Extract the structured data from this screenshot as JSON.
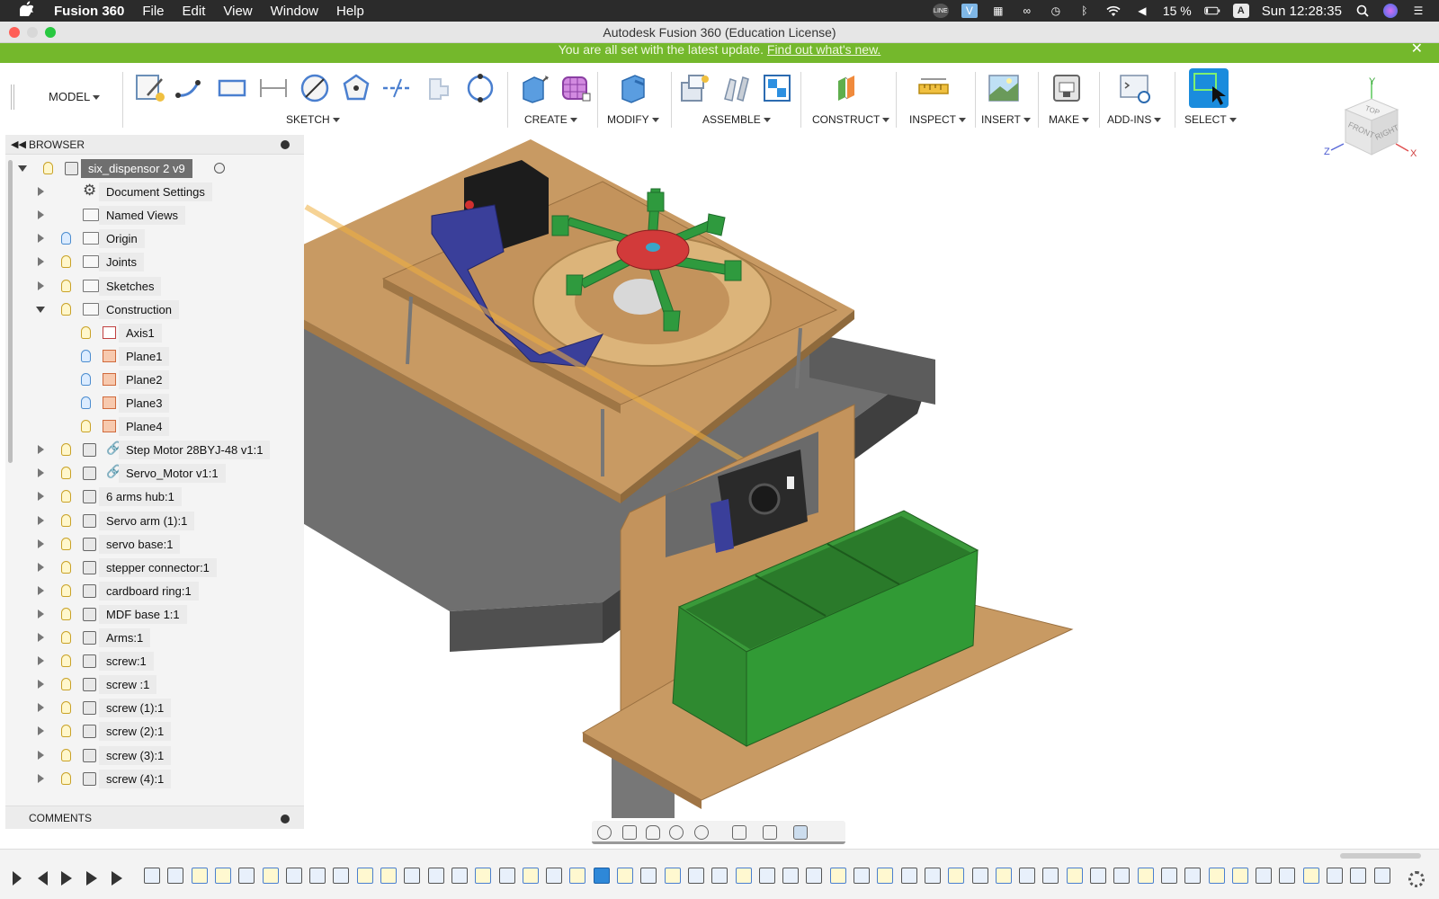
{
  "menubar": {
    "app_name": "Fusion 360",
    "menus": [
      "File",
      "Edit",
      "View",
      "Window",
      "Help"
    ],
    "status": {
      "line_label": "LINE",
      "v_label": "V",
      "battery": "15 %",
      "input_label": "A",
      "clock": "Sun 12:28:35"
    }
  },
  "window": {
    "title": "Autodesk Fusion 360 (Education License)"
  },
  "banner": {
    "text": "You are all set with the latest update.",
    "link": "Find out what's new.",
    "close": "✕"
  },
  "toolbar": {
    "workspace": "MODEL",
    "groups": [
      "SKETCH",
      "CREATE",
      "MODIFY",
      "ASSEMBLE",
      "CONSTRUCT",
      "INSPECT",
      "INSERT",
      "MAKE",
      "ADD-INS",
      "SELECT"
    ]
  },
  "viewcube": {
    "top": "TOP",
    "front": "FRONT",
    "right": "RIGHT",
    "x": "X",
    "y": "Y",
    "z": "Z"
  },
  "browser": {
    "title": "BROWSER",
    "root": "six_dispensor 2 v9",
    "items": [
      {
        "label": "Document Settings"
      },
      {
        "label": "Named Views"
      },
      {
        "label": "Origin"
      },
      {
        "label": "Joints"
      },
      {
        "label": "Sketches"
      },
      {
        "label": "Construction"
      },
      {
        "label": "Axis1"
      },
      {
        "label": "Plane1"
      },
      {
        "label": "Plane2"
      },
      {
        "label": "Plane3"
      },
      {
        "label": "Plane4"
      },
      {
        "label": "Step Motor 28BYJ-48 v1:1"
      },
      {
        "label": "Servo_Motor v1:1"
      },
      {
        "label": "6 arms hub:1"
      },
      {
        "label": "Servo arm (1):1"
      },
      {
        "label": "servo base:1"
      },
      {
        "label": "stepper connector:1"
      },
      {
        "label": "cardboard ring:1"
      },
      {
        "label": "MDF base 1:1"
      },
      {
        "label": "Arms:1"
      },
      {
        "label": "screw:1"
      },
      {
        "label": "screw :1"
      },
      {
        "label": "screw (1):1"
      },
      {
        "label": "screw (2):1"
      },
      {
        "label": "screw (3):1"
      },
      {
        "label": "screw (4):1"
      }
    ]
  },
  "comments": {
    "title": "COMMENTS"
  },
  "colors": {
    "accent": "#2e88d8",
    "banner": "#74b82c",
    "mdf": "#c89a63",
    "green": "#2f9a3e",
    "red": "#d23a3a",
    "navy": "#3a3f9a"
  }
}
